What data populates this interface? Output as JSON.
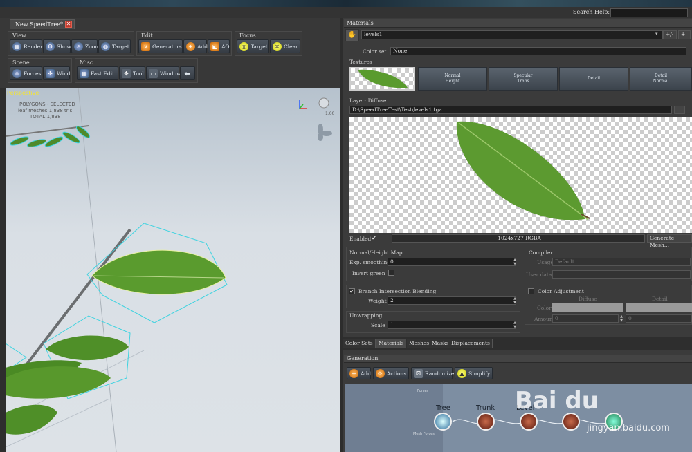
{
  "search": {
    "label": "Search Help:",
    "value": ""
  },
  "document_tab": {
    "label": "New SpeedTree*",
    "close_glyph": "✕"
  },
  "toolbar": {
    "view": {
      "label": "View",
      "buttons": [
        "Render",
        "Show",
        "Zoom",
        "Target"
      ]
    },
    "edit": {
      "label": "Edit",
      "buttons": [
        "Generators",
        "Add",
        "AO"
      ]
    },
    "focus": {
      "label": "Focus",
      "buttons": [
        "Target",
        "Clear"
      ]
    },
    "scene": {
      "label": "Scene",
      "buttons": [
        "Forces",
        "Wind"
      ]
    },
    "misc": {
      "label": "Misc",
      "buttons": [
        "Fast Edit",
        "Tool",
        "Window"
      ]
    }
  },
  "viewport": {
    "mode": "Perspective",
    "polygons_label": "POLYGONS - SELECTED",
    "leaf_meshes": "leaf meshes:1,838 tris",
    "total": "TOTAL:1,838",
    "fps": "1.00"
  },
  "materials_panel": {
    "title": "Materials",
    "material_name": "levels1",
    "plus_minus": "+/-",
    "color_set_label": "Color set",
    "color_set_value": "None",
    "textures_label": "Textures",
    "texture_slots": [
      {
        "line1": "Normal",
        "line2": "Height"
      },
      {
        "line1": "Specular",
        "line2": "Trans"
      },
      {
        "line1": "Detail",
        "line2": ""
      },
      {
        "line1": "Detail",
        "line2": "Normal"
      }
    ],
    "layer_label": "Layer: Diffuse",
    "texture_path": "D:\\SpeedTreeTest\\Test\\levels1.tga",
    "browse_label": "...",
    "enabled_label": "Enabled",
    "resolution": "1024x727  RGBA",
    "generate_mesh": "Generate Mesh...",
    "normal_height": {
      "title": "Normal/Height Map",
      "smoothing_label": "Exp. smoothing",
      "smoothing_value": "0",
      "invert_green_label": "Invert green"
    },
    "compiler": {
      "title": "Compiler",
      "usage_label": "Usage",
      "usage_value": "Default",
      "user_data_label": "User data"
    },
    "branch_blending": {
      "title": "Branch Intersection Blending",
      "weight_label": "Weight",
      "weight_value": "2"
    },
    "color_adjustment": {
      "title": "Color Adjustment",
      "diffuse_header": "Diffuse",
      "detail_header": "Detail",
      "color_label": "Color",
      "amount_label": "Amount",
      "amount_diffuse": "0",
      "amount_detail": "0"
    },
    "unwrapping": {
      "title": "Unwrapping",
      "scale_label": "Scale",
      "scale_value": "1"
    }
  },
  "bottom_tabs": [
    "Color Sets",
    "Materials",
    "Meshes",
    "Masks",
    "Displacements"
  ],
  "active_bottom_tab": "Materials",
  "generation": {
    "title": "Generation",
    "buttons": [
      "Add",
      "Actions",
      "Randomize",
      "Simplify"
    ],
    "side_labels": [
      "Forces",
      "Mesh Forces"
    ],
    "nodes": [
      "Tree",
      "Trunk",
      "Level"
    ]
  },
  "watermark": {
    "logo": "Bai du",
    "text": "jingyan.baidu.com"
  },
  "colors": {
    "accent_yellow": "#f5e431",
    "panel": "#3b3b3b",
    "viewport_sky": "#c8d1d9",
    "selection_cyan": "#3fd3e0",
    "leaf_green": "#5a9b2e"
  }
}
